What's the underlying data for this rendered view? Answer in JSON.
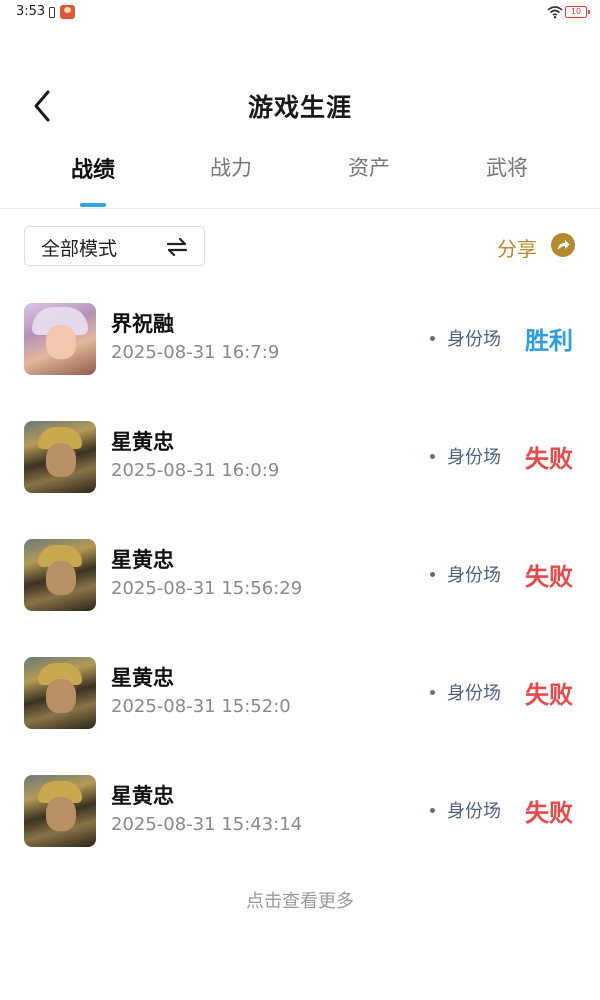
{
  "status_bar": {
    "time": "3:53",
    "battery": "10",
    "battery_color": "#e53b3b"
  },
  "header": {
    "title": "游戏生涯",
    "back_icon": "chevron-left-icon"
  },
  "tabs": [
    {
      "label": "战绩",
      "active": true
    },
    {
      "label": "战力",
      "active": false
    },
    {
      "label": "资产",
      "active": false
    },
    {
      "label": "武将",
      "active": false
    }
  ],
  "filter": {
    "mode_label": "全部模式",
    "swap_icon": "swap-arrows-icon"
  },
  "share": {
    "label": "分享",
    "icon": "share-arrow-icon",
    "color": "#b58a2e"
  },
  "records": [
    {
      "hero": "界祝融",
      "time": "2025-08-31 16:7:9",
      "mode": "身份场",
      "result": "胜利",
      "outcome": "win"
    },
    {
      "hero": "星黄忠",
      "time": "2025-08-31 16:0:9",
      "mode": "身份场",
      "result": "失败",
      "outcome": "lose"
    },
    {
      "hero": "星黄忠",
      "time": "2025-08-31 15:56:29",
      "mode": "身份场",
      "result": "失败",
      "outcome": "lose"
    },
    {
      "hero": "星黄忠",
      "time": "2025-08-31 15:52:0",
      "mode": "身份场",
      "result": "失败",
      "outcome": "lose"
    },
    {
      "hero": "星黄忠",
      "time": "2025-08-31 15:43:14",
      "mode": "身份场",
      "result": "失败",
      "outcome": "lose"
    }
  ],
  "colors": {
    "tab_indicator": "#2ba6e6",
    "win": "#2b9ee6",
    "lose": "#e84a4a"
  },
  "load_more": "点击查看更多"
}
